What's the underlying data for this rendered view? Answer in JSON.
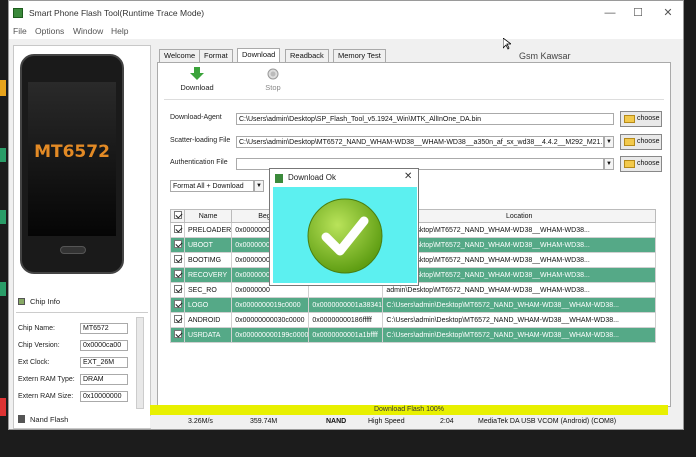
{
  "window": {
    "title": "Smart Phone Flash Tool(Runtime Trace Mode)",
    "controls": [
      "—",
      "☐",
      "✕"
    ]
  },
  "menu": [
    "File",
    "Options",
    "Window",
    "Help"
  ],
  "watermark": "Gsm Kawsar",
  "phone": {
    "chip": "MT6572"
  },
  "chip_info": {
    "title": "Chip Info",
    "fields": [
      {
        "label": "Chip Name:",
        "value": "MT6572"
      },
      {
        "label": "Chip Version:",
        "value": "0x0000ca00"
      },
      {
        "label": "Ext Clock:",
        "value": "EXT_26M"
      },
      {
        "label": "Extern RAM Type:",
        "value": "DRAM"
      },
      {
        "label": "Extern RAM Size:",
        "value": "0x10000000"
      }
    ],
    "nand_label": "Nand Flash"
  },
  "tabs": [
    "Welcome",
    "Format",
    "Download",
    "Readback",
    "Memory Test"
  ],
  "toolbar": {
    "download": "Download",
    "stop": "Stop"
  },
  "form": {
    "download_agent_label": "Download-Agent",
    "download_agent_value": "C:\\Users\\admin\\Desktop\\SP_Flash_Tool_v5.1924_Win\\MTK_AllInOne_DA.bin",
    "scatter_label": "Scatter-loading File",
    "scatter_value": "C:\\Users\\admin\\Desktop\\MT6572_NAND_WHAM-WD38__WHAM-WD38__a350n_af_sx_wd38__4.4.2__M292_M21...",
    "auth_label": "Authentication File",
    "auth_value": "",
    "choose": "choose",
    "format_select": "Format All + Download"
  },
  "table": {
    "headers": [
      "",
      "Name",
      "Begin A",
      "",
      "Location"
    ],
    "rows": [
      {
        "name": "PRELOADER",
        "begin": "0x0000000",
        "end": "",
        "location": "admin\\Desktop\\MT6572_NAND_WHAM-WD38__WHAM-WD38...",
        "green": false
      },
      {
        "name": "UBOOT",
        "begin": "0x0000000",
        "end": "",
        "location": "admin\\Desktop\\MT6572_NAND_WHAM-WD38__WHAM-WD38...",
        "green": true
      },
      {
        "name": "BOOTIMG",
        "begin": "0x0000000",
        "end": "",
        "location": "admin\\Desktop\\MT6572_NAND_WHAM-WD38__WHAM-WD38...",
        "green": false
      },
      {
        "name": "RECOVERY",
        "begin": "0x0000000",
        "end": "",
        "location": "admin\\Desktop\\MT6572_NAND_WHAM-WD38__WHAM-WD38...",
        "green": true
      },
      {
        "name": "SEC_RO",
        "begin": "0x0000000",
        "end": "",
        "location": "admin\\Desktop\\MT6572_NAND_WHAM-WD38__WHAM-WD38...",
        "green": false
      },
      {
        "name": "LOGO",
        "begin": "0x0000000019c0000",
        "end": "0x0000000001a38341",
        "location": "C:\\Users\\admin\\Desktop\\MT6572_NAND_WHAM-WD38__WHAM-WD38...",
        "green": true
      },
      {
        "name": "ANDROID",
        "begin": "0x00000000030c0000",
        "end": "0x00000000186fffff",
        "location": "C:\\Users\\admin\\Desktop\\MT6572_NAND_WHAM-WD38__WHAM-WD38...",
        "green": false
      },
      {
        "name": "USRDATA",
        "begin": "0x000000000199c0000",
        "end": "0x0000000001a1bffff",
        "location": "C:\\Users\\admin\\Desktop\\MT6572_NAND_WHAM-WD38__WHAM-WD38...",
        "green": true
      }
    ]
  },
  "progress": {
    "label": "Download Flash 100%",
    "fraction": 1.0
  },
  "status": {
    "speed": "3.26M/s",
    "size": "359.74M",
    "type": "NAND",
    "mode": "High Speed",
    "time": "2:04",
    "port": "MediaTek DA USB VCOM (Android) (COM8)"
  },
  "dialog": {
    "title": "Download Ok",
    "close": "✕"
  },
  "colors": {
    "row_green": "#55a987",
    "dialog_bg": "#5cf0f0",
    "progress": "#e8f000",
    "chip_text": "#e38a25"
  }
}
